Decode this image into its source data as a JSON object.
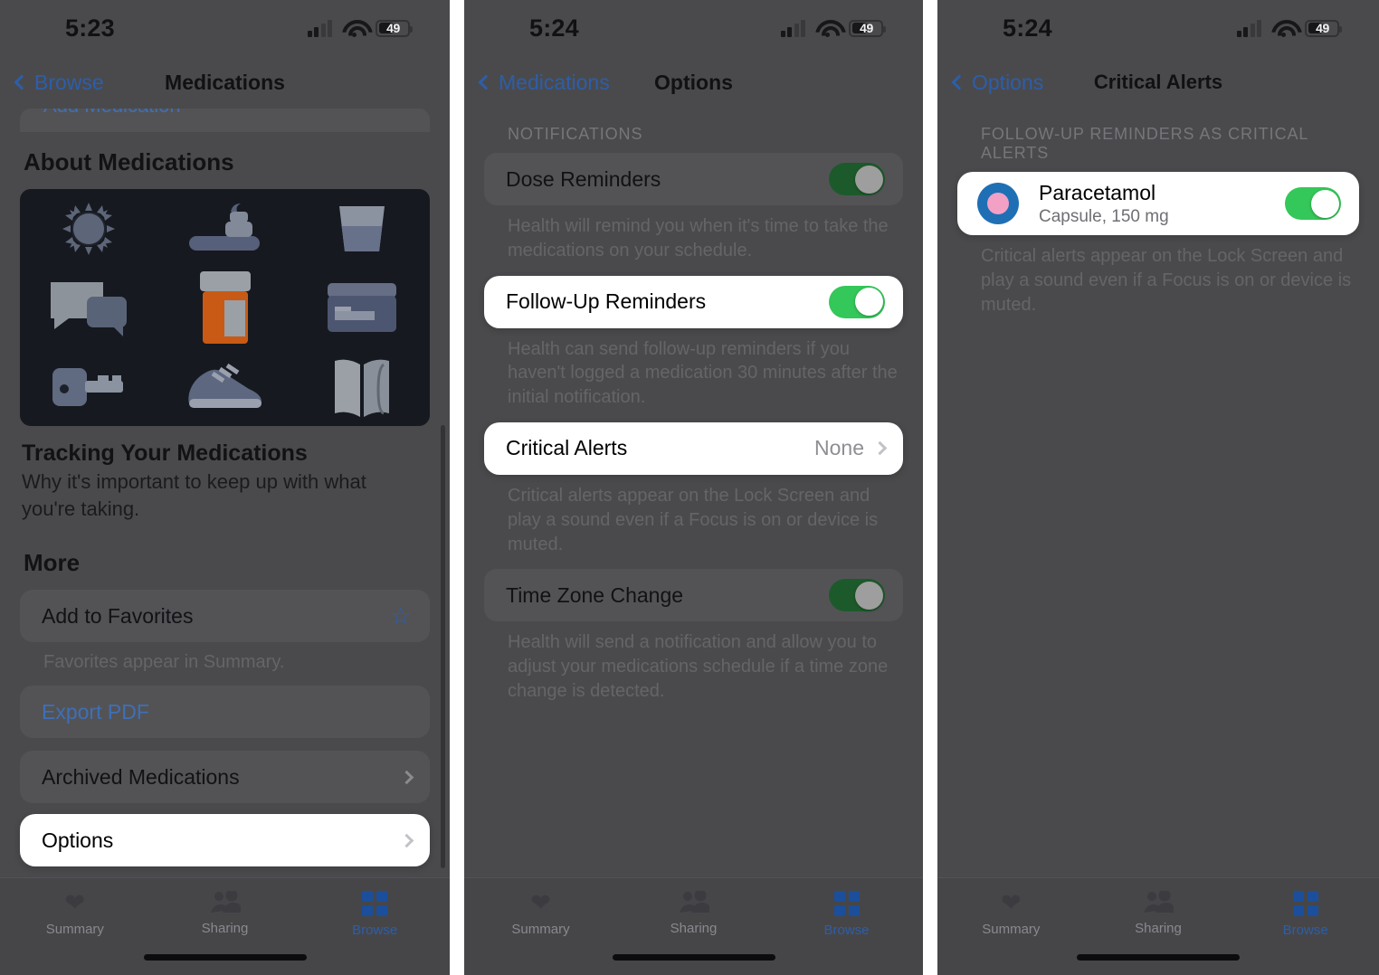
{
  "panels": [
    {
      "status": {
        "time": "5:23",
        "battery_pct": "49"
      },
      "nav": {
        "back_label": "Browse",
        "title": "Medications"
      },
      "cut_row_label": "Add Medication",
      "about": {
        "section_title": "About Medications",
        "card_title": "Tracking Your Medications",
        "card_sub": "Why it's important to keep up with what you're taking.",
        "illustration_icons": [
          "sun-icon",
          "soap-dispenser-icon",
          "cup-icon",
          "speech-bubbles-icon",
          "pill-bottle-icon",
          "box-icon",
          "key-icon",
          "sneaker-icon",
          "book-icon"
        ]
      },
      "more": {
        "section_title": "More",
        "favorites_label": "Add to Favorites",
        "favorites_note": "Favorites appear in Summary.",
        "export_label": "Export PDF",
        "archived_label": "Archived Medications",
        "options_label": "Options"
      },
      "tabs": [
        {
          "label": "Summary",
          "icon": "heart-icon",
          "active": false
        },
        {
          "label": "Sharing",
          "icon": "people-icon",
          "active": false
        },
        {
          "label": "Browse",
          "icon": "grid-icon",
          "active": true
        }
      ]
    },
    {
      "status": {
        "time": "5:24",
        "battery_pct": "49"
      },
      "nav": {
        "back_label": "Medications",
        "title": "Options"
      },
      "section_caps": "NOTIFICATIONS",
      "rows": {
        "dose_label": "Dose Reminders",
        "dose_note": "Health will remind you when it's time to take the medications on your schedule.",
        "followup_label": "Follow-Up Reminders",
        "followup_note": "Health can send follow-up reminders if you haven't logged a medication 30 minutes after the initial notification.",
        "critical_label": "Critical Alerts",
        "critical_value": "None",
        "critical_note": "Critical alerts appear on the Lock Screen and play a sound even if a Focus is on or device is muted.",
        "timezone_label": "Time Zone Change",
        "timezone_note": "Health will send a notification and allow you to adjust your medications schedule if a time zone change is detected."
      },
      "tabs": [
        {
          "label": "Summary",
          "icon": "heart-icon",
          "active": false
        },
        {
          "label": "Sharing",
          "icon": "people-icon",
          "active": false
        },
        {
          "label": "Browse",
          "icon": "grid-icon",
          "active": true
        }
      ]
    },
    {
      "status": {
        "time": "5:24",
        "battery_pct": "49"
      },
      "nav": {
        "back_label": "Options",
        "title": "Critical Alerts"
      },
      "section_caps": "FOLLOW-UP REMINDERS AS CRITICAL ALERTS",
      "medication": {
        "name": "Paracetamol",
        "dose": "Capsule, 150 mg"
      },
      "note": "Critical alerts appear on the Lock Screen and play a sound even if a Focus is on or device is muted.",
      "tabs": [
        {
          "label": "Summary",
          "icon": "heart-icon",
          "active": false
        },
        {
          "label": "Sharing",
          "icon": "people-icon",
          "active": false
        },
        {
          "label": "Browse",
          "icon": "grid-icon",
          "active": true
        }
      ]
    }
  ],
  "colors": {
    "toggle_on": "#34c759",
    "toggle_dim": "#1d5a2b",
    "accent_blue": "#2d5ea8",
    "pill_orange": "#c85a15"
  }
}
